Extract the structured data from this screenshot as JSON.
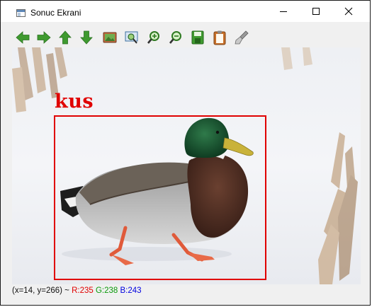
{
  "window": {
    "title": "Sonuc Ekrani"
  },
  "toolbar": {
    "buttons": [
      {
        "name": "arrow-left-icon",
        "color": "#3f9a2f"
      },
      {
        "name": "arrow-right-icon",
        "color": "#3f9a2f"
      },
      {
        "name": "arrow-up-icon",
        "color": "#3f9a2f"
      },
      {
        "name": "arrow-down-icon",
        "color": "#3f9a2f"
      },
      {
        "name": "image-icon",
        "color": "#b05a3a"
      },
      {
        "name": "zoom-window-icon",
        "color": "#2f6db0"
      },
      {
        "name": "zoom-in-icon",
        "color": "#3f9a2f"
      },
      {
        "name": "zoom-out-icon",
        "color": "#3f9a2f"
      },
      {
        "name": "save-icon",
        "color": "#3f9a2f"
      },
      {
        "name": "clipboard-icon",
        "color": "#c8702a"
      },
      {
        "name": "brush-icon",
        "color": "#8a8a8a"
      }
    ]
  },
  "detection": {
    "label": "kus",
    "color": "#e00000"
  },
  "status": {
    "coords": "(x=14, y=266) ~ ",
    "r": "R:235",
    "g": "G:238",
    "b": "B:243",
    "r_color": "#e00000",
    "g_color": "#0a9a0a",
    "b_color": "#0000e0"
  }
}
